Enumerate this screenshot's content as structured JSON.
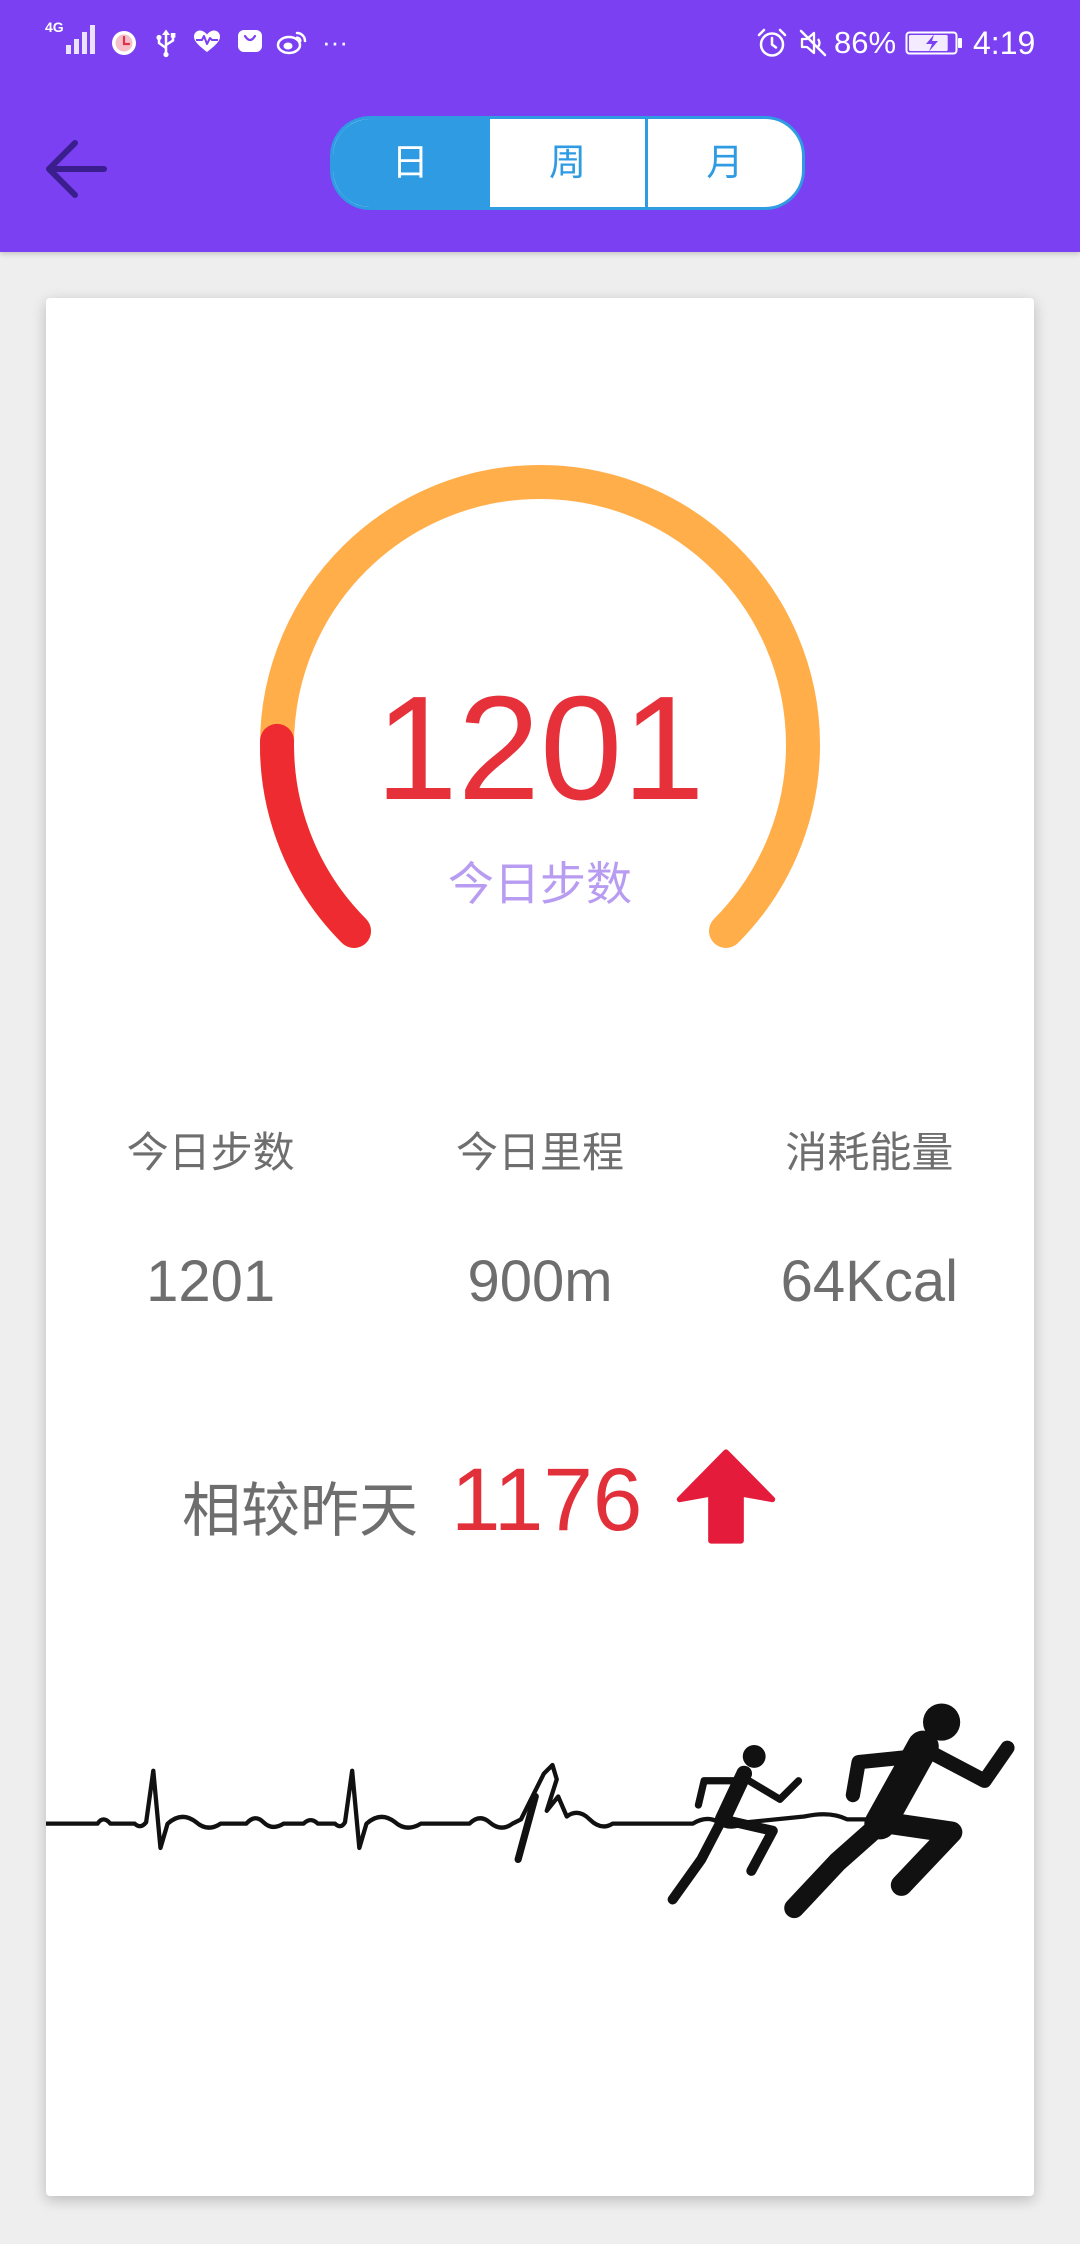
{
  "status_bar": {
    "network": "4G",
    "more": "···",
    "battery_percent": "86%",
    "battery_level": 0.86,
    "charging": true,
    "time": "4:19"
  },
  "header": {
    "tabs": [
      {
        "label": "日",
        "selected": true
      },
      {
        "label": "周",
        "selected": false
      },
      {
        "label": "月",
        "selected": false
      }
    ]
  },
  "gauge": {
    "value": "1201",
    "label": "今日步数",
    "progress": 0.17
  },
  "stats": [
    {
      "label": "今日步数",
      "value": "1201"
    },
    {
      "label": "今日里程",
      "value": "900m"
    },
    {
      "label": "消耗能量",
      "value": "64Kcal"
    }
  ],
  "comparison": {
    "label": "相较昨天",
    "value": "1176"
  },
  "icons": {
    "status_left": [
      "signal-icon",
      "app-notification-icon",
      "usb-icon",
      "health-icon",
      "app-gallery-icon",
      "weibo-icon"
    ],
    "status_right": [
      "alarm-icon",
      "mute-icon",
      "battery-icon"
    ],
    "back": "arrow-left-icon",
    "trend": "arrow-up-icon",
    "illustration": "heartbeat-runners-icon"
  },
  "colors": {
    "header_bg": "#7B40F2",
    "back_arrow": "#3B1E8E",
    "tab_accent": "#2E9BE3",
    "page_bg": "#EEEEEE",
    "gauge_track": "#FFAE4A",
    "gauge_progress": "#EE2B30",
    "gauge_value": "#E6313B",
    "gauge_label": "#B89CF2",
    "stat_text": "#6E6E6E",
    "comparison_value": "#E2303A",
    "trend_arrow": "#E41B3B"
  }
}
